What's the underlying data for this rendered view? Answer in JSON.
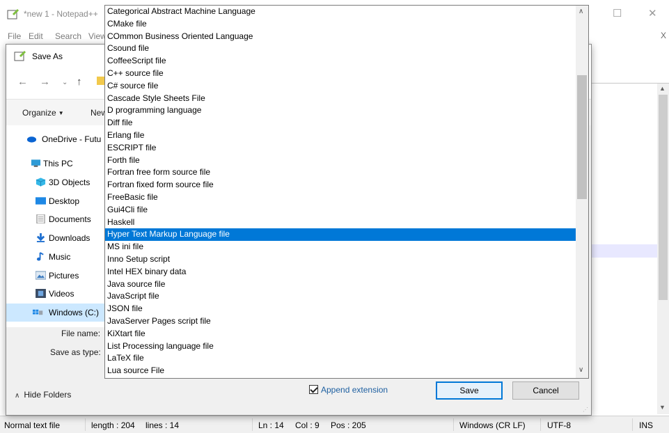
{
  "notepad": {
    "title": "*new 1 - Notepad++",
    "menu": [
      "File",
      "Edit",
      "Search",
      "View"
    ],
    "close_doc": "X",
    "win_minimize": "—",
    "win_maximize": "☐",
    "win_close": "✕"
  },
  "dialog": {
    "title": "Save As",
    "organize_label": "Organize",
    "new_folder_label": "New folder",
    "tree": [
      {
        "label": "OneDrive - Futu",
        "icon": "cloud-icon"
      },
      {
        "label": "This PC",
        "icon": "computer-icon"
      },
      {
        "label": "3D Objects",
        "icon": "cube-icon"
      },
      {
        "label": "Desktop",
        "icon": "desktop-icon"
      },
      {
        "label": "Documents",
        "icon": "document-icon"
      },
      {
        "label": "Downloads",
        "icon": "download-icon"
      },
      {
        "label": "Music",
        "icon": "music-icon"
      },
      {
        "label": "Pictures",
        "icon": "pictures-icon"
      },
      {
        "label": "Videos",
        "icon": "video-icon"
      },
      {
        "label": "Windows (C:)",
        "icon": "drive-icon"
      }
    ],
    "file_name_label": "File name:",
    "save_as_type_label": "Save as type:",
    "hide_folders_label": "Hide Folders",
    "append_extension_label": "Append extension",
    "append_extension_checked": true,
    "save_label": "Save",
    "cancel_label": "Cancel"
  },
  "dropdown": {
    "selected_index": 18,
    "items": [
      "Categorical Abstract Machine Language",
      "CMake file",
      "COmmon Business Oriented Language",
      "Csound file",
      "CoffeeScript file",
      "C++ source file",
      "C# source file",
      "Cascade Style Sheets File",
      "D programming language",
      "Diff file",
      "Erlang file",
      "ESCRIPT file",
      "Forth file",
      "Fortran free form source file",
      "Fortran fixed form source file",
      "FreeBasic file",
      "Gui4Cli file",
      "Haskell",
      "Hyper Text Markup Language file",
      "MS ini file",
      "Inno Setup script",
      "Intel HEX binary data",
      "Java source file",
      "JavaScript file",
      "JSON file",
      "JavaServer Pages script file",
      "KiXtart file",
      "List Processing language file",
      "LaTeX file",
      "Lua source File"
    ]
  },
  "statusbar": {
    "file_type": "Normal text file",
    "length": "length : 204",
    "lines": "lines : 14",
    "ln": "Ln : 14",
    "col": "Col : 9",
    "pos": "Pos : 205",
    "eol": "Windows (CR LF)",
    "encoding": "UTF-8",
    "mode": "INS"
  },
  "colors": {
    "accent": "#0078d7",
    "selection_light": "#cce8ff",
    "current_line": "#e8e8ff"
  }
}
